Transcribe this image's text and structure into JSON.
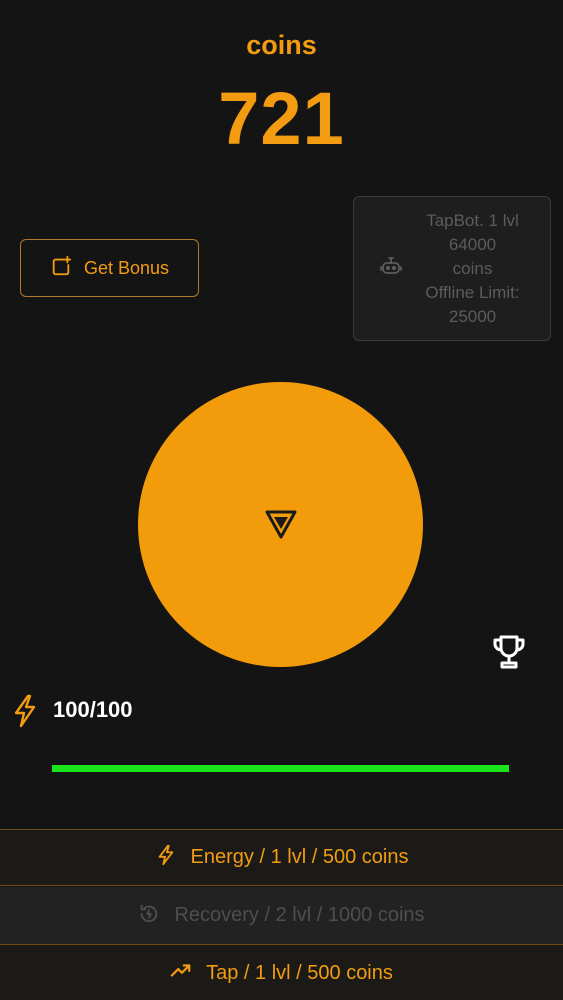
{
  "header": {
    "coins_label": "coins",
    "coins_value": "721"
  },
  "bonus": {
    "label": "Get Bonus",
    "icon": "add-box-icon"
  },
  "tapbot": {
    "icon": "robot-icon",
    "lines": [
      "TapBot. 1 lvl",
      "64000",
      "coins",
      "Offline Limit:",
      "25000"
    ]
  },
  "tap": {
    "icon": "triangle-logo-icon"
  },
  "leaderboard": {
    "icon": "trophy-icon"
  },
  "energy": {
    "icon": "lightning-icon",
    "value": "100/100",
    "fill_fraction": 1.0
  },
  "upgrades": {
    "energy": {
      "label": "Energy / 1 lvl / 500 coins",
      "icon": "lightning-icon"
    },
    "recovery": {
      "label": "Recovery / 2 lvl / 1000 coins",
      "icon": "recovery-icon"
    },
    "tap": {
      "label": "Tap / 1 lvl / 500 coins",
      "icon": "trending-up-icon"
    }
  },
  "colors": {
    "accent": "#f39c12",
    "background": "#141414",
    "energy_bar": "#1be51b",
    "disabled_text": "#4e4e4e"
  }
}
